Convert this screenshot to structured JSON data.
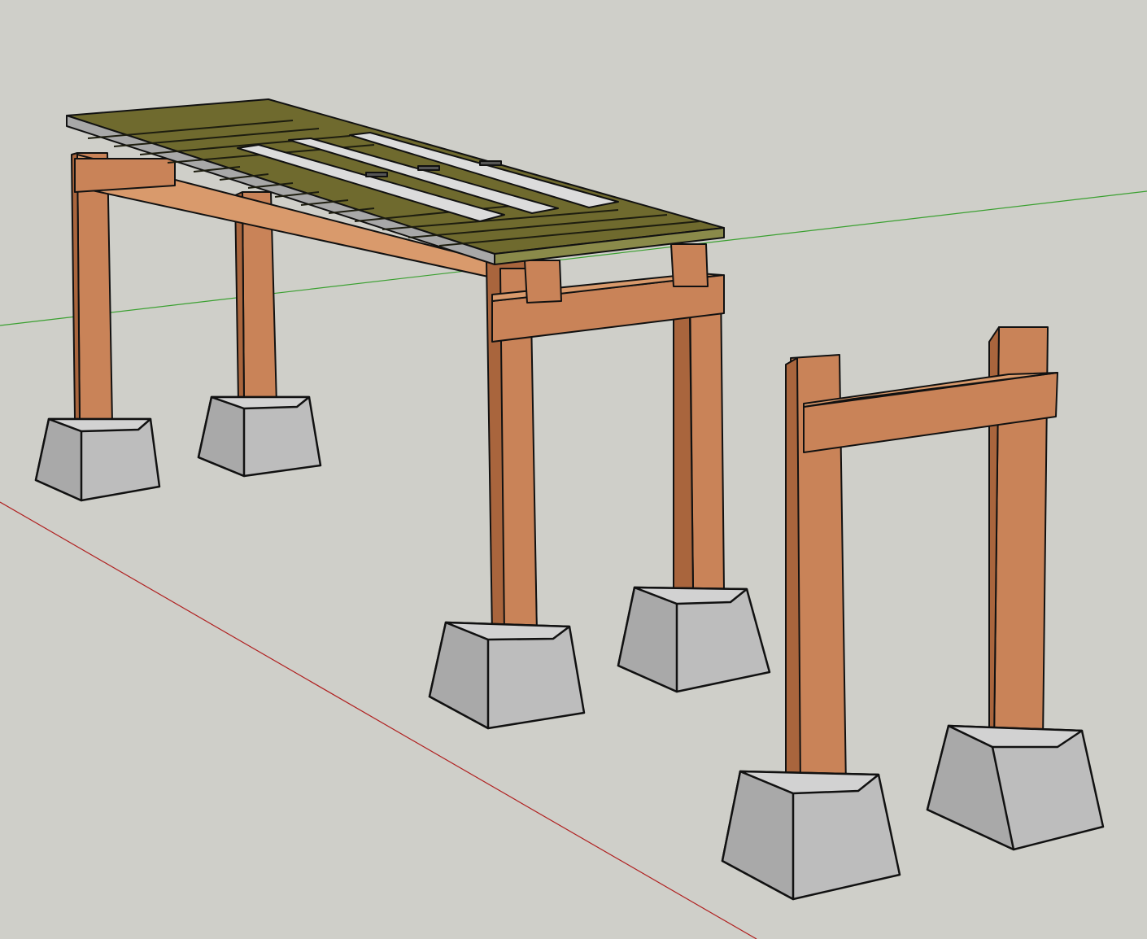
{
  "viewport": {
    "background": "#cfcfc9"
  },
  "axes": {
    "red_axis_color": "#b02020",
    "green_axis_color": "#3aa030"
  },
  "materials": {
    "wood_front": "#c98358",
    "wood_side": "#a9653d",
    "wood_top": "#d99a6c",
    "deck_top": "#6f6a2e",
    "deck_edge": "#8a8a4a",
    "metal_strip": "#dcdcdc",
    "metal_edge": "#a8a8a8",
    "concrete_front": "#bdbdbd",
    "concrete_side": "#a9a9a9",
    "concrete_top": "#d2d2d2",
    "outline": "#111111"
  },
  "scene": {
    "objects": [
      {
        "name": "bench-frame",
        "type": "component"
      },
      {
        "name": "slatted-deck",
        "type": "group"
      },
      {
        "name": "metal-strips",
        "type": "group"
      },
      {
        "name": "h-frame-unattached",
        "type": "component"
      },
      {
        "name": "concrete-pier-blocks",
        "type": "group",
        "count": 6
      }
    ]
  }
}
